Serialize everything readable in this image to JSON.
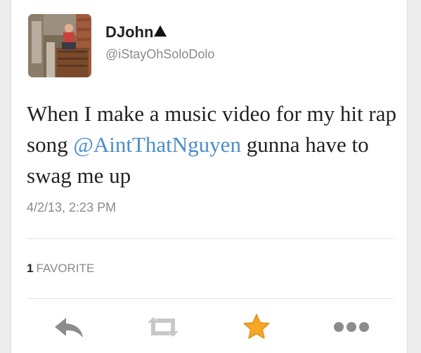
{
  "tweet": {
    "display_name": "DJohn",
    "handle": "@iStayOhSoloDolo",
    "text_before": "When I make a music video for my hit rap song ",
    "mention": "@AintThatNguyen",
    "text_after": " gunna have to swag me up",
    "timestamp": "4/2/13, 2:23 PM"
  },
  "stats": {
    "favorite_count": "1",
    "favorite_label": "FAVORITE"
  },
  "actions": {
    "reply_icon": "reply-arrow-icon",
    "retweet_icon": "retweet-icon",
    "favorite_icon": "star-icon",
    "more_icon": "more-dots-icon"
  },
  "colors": {
    "mention": "#4a8ec9",
    "favorited_star": "#f5a623",
    "icon_gray": "#8c8c8c",
    "retweet_gray": "#c8c8c8"
  }
}
